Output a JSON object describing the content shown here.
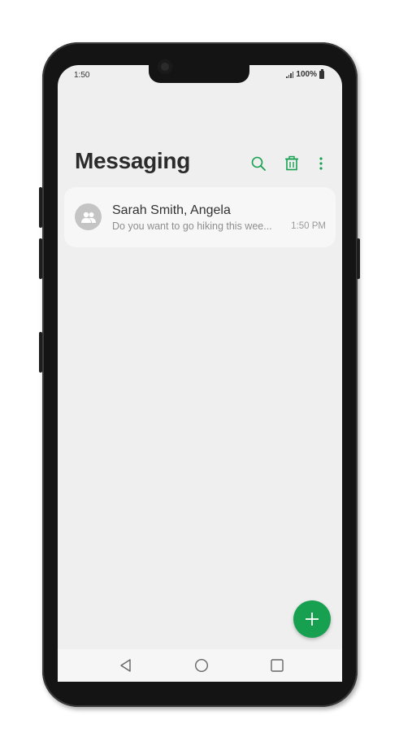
{
  "status_bar": {
    "time": "1:50",
    "battery": "100%"
  },
  "header": {
    "title": "Messaging"
  },
  "toolbar": {
    "icons": [
      "search-icon",
      "trash-icon",
      "more-vert-icon"
    ]
  },
  "conversations": [
    {
      "name": "Sarah Smith, Angela",
      "preview": "Do you want to go hiking this wee...",
      "time": "1:50 PM",
      "avatar_icon": "group-icon"
    }
  ],
  "fab": {
    "icon": "plus-icon"
  },
  "nav_bar": {
    "icons": [
      "back-icon",
      "home-icon",
      "recents-icon"
    ]
  },
  "colors": {
    "accent": "#17a050",
    "screen_bg": "#efefef",
    "card_bg": "#f7f7f7",
    "title_text": "#2b2b2b",
    "secondary_text": "#8e8e8e"
  }
}
